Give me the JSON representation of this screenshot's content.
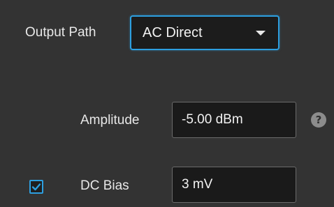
{
  "output_path": {
    "label": "Output Path",
    "selected": "AC Direct",
    "caret_icon": "chevron-down-icon"
  },
  "amplitude": {
    "label": "Amplitude",
    "value": "-5.00 dBm",
    "help_icon": "help-icon",
    "help_glyph": "?"
  },
  "dc_bias": {
    "label": "DC Bias",
    "value": "3 mV",
    "checked": true
  },
  "colors": {
    "background": "#333333",
    "accent": "#2d9fe0",
    "field_background": "#1a1a1a"
  }
}
